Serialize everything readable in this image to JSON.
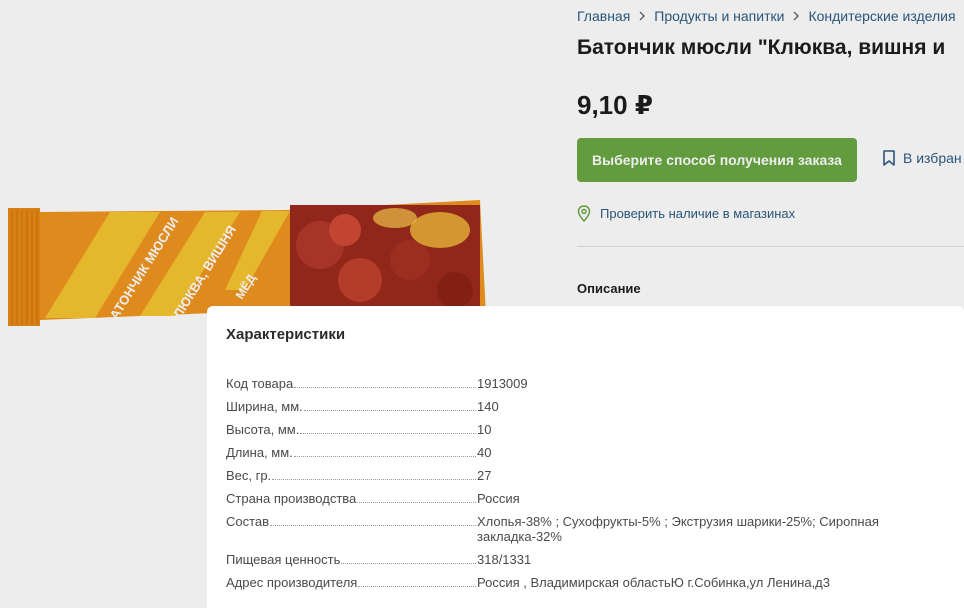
{
  "breadcrumb": [
    "Главная",
    "Продукты и напитки",
    "Кондитерские изделия"
  ],
  "product": {
    "title": "Батончик мюсли \"Клюква, вишня и",
    "price": "9,10 ₽",
    "order_button_label": "Выберите способ получения заказа",
    "favorite_label": "В избран",
    "availability_label": "Проверить наличие в магазинах",
    "image": {
      "line1": "БАТОНЧИК МЮСЛИ",
      "line2": "КЛЮКВА, ВИШНЯ",
      "line3": "МЁД"
    }
  },
  "tabs": {
    "description": "Описание"
  },
  "modal": {
    "title": "Характеристики",
    "specs": [
      {
        "name": "Код товара",
        "value": "1913009"
      },
      {
        "name": "Ширина, мм.",
        "value": "140"
      },
      {
        "name": "Высота, мм.",
        "value": "10"
      },
      {
        "name": "Длина, мм.",
        "value": "40"
      },
      {
        "name": "Вес, гр.",
        "value": "27"
      },
      {
        "name": "Страна производства",
        "value": "Россия"
      },
      {
        "name": "Состав",
        "value": "Хлопья-38% ; Сухофрукты-5% ; Экструзия шарики-25%; Сиропная закладка-32%"
      },
      {
        "name": "Пищевая ценность",
        "value": "318/1331"
      },
      {
        "name": "Адрес производителя",
        "value": "Россия , Владимирская областьЮ г.Собинка,ул Ленина,д3"
      }
    ]
  },
  "colors": {
    "accent_green": "#6aa843",
    "link_blue": "#2f5c84",
    "wrapper_orange": "#f0951f"
  },
  "icons": [
    "chevron-right-icon",
    "bookmark-icon",
    "map-pin-icon"
  ]
}
